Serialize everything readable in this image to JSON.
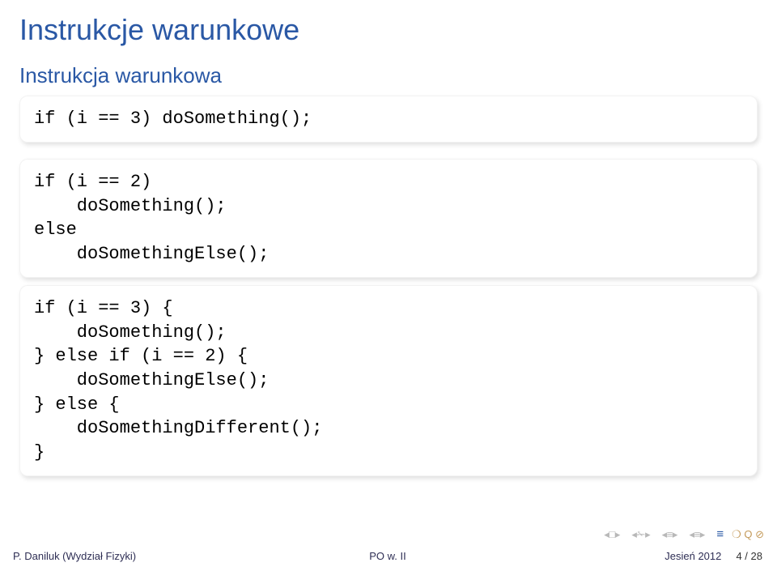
{
  "title": "Instrukcje warunkowe",
  "subtitle": "Instrukcja warunkowa",
  "code1": "if (i == 3) doSomething();",
  "code2": "if (i == 2)\n    doSomething();\nelse\n    doSomethingElse();",
  "code3": "if (i == 3) {\n    doSomething();\n} else if (i == 2) {\n    doSomethingElse();\n} else {\n    doSomethingDifferent();\n}",
  "footer": {
    "author": "P. Daniluk (Wydział Fizyki)",
    "center": "PO w. II",
    "right_label": "Jesień 2012",
    "slide_current": "4",
    "slide_sep": " / ",
    "slide_total": "28"
  },
  "nav": {
    "frame_prev": "◂ □ ▸",
    "subsec_prev": "◂ ✁ ▸",
    "sec_prev": "◂ ≡ ▸",
    "sec_next": "◂ ≡ ▸",
    "equiv": "≡",
    "circ": "❍ Q ⊘"
  }
}
